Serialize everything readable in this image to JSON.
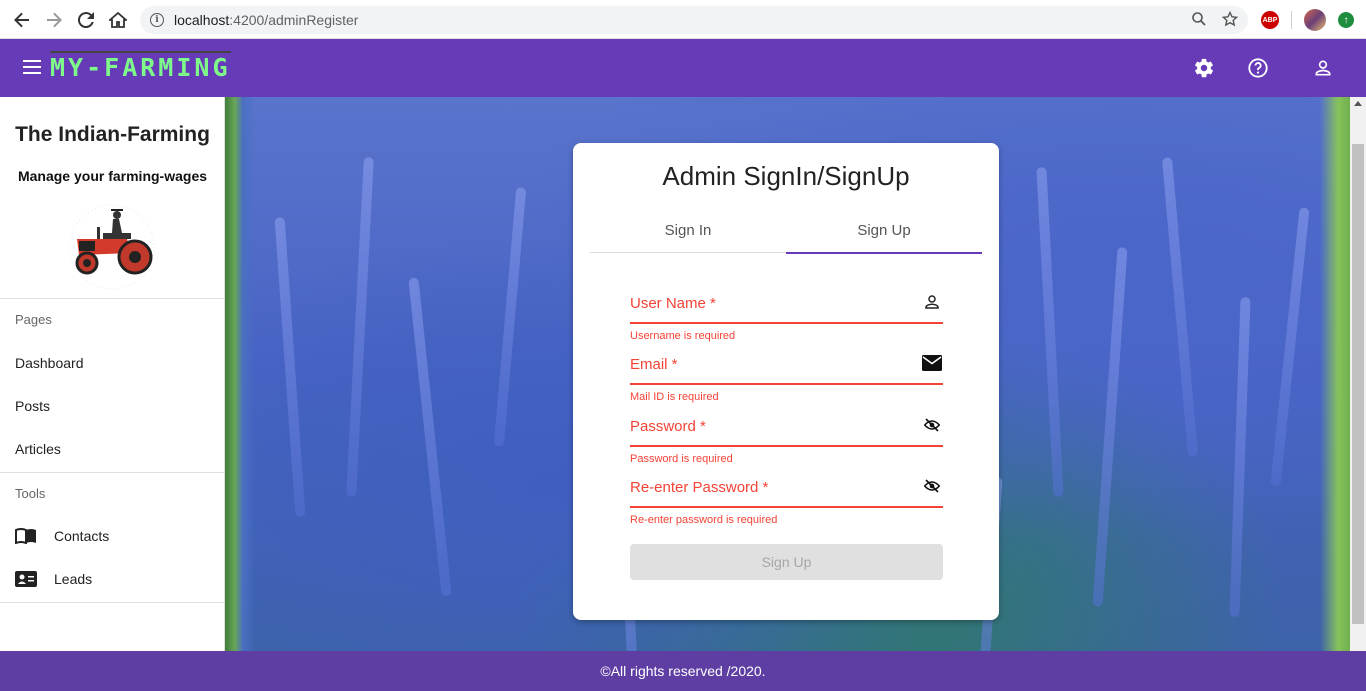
{
  "browser": {
    "url_host": "localhost",
    "url_path": ":4200/adminRegister",
    "icons": [
      "back-icon",
      "forward-icon",
      "reload-icon",
      "home-icon",
      "info-icon",
      "zoom-icon",
      "star-icon",
      "abp-icon",
      "profile-avatar",
      "extension-icon"
    ],
    "abp_label": "ABP"
  },
  "toolbar": {
    "logo": "MY-FARMING",
    "bg_color": "#673ab7",
    "logo_color": "#7dfa8a",
    "icons": [
      "menu-icon",
      "settings-icon",
      "help-icon",
      "account-icon"
    ]
  },
  "sidebar": {
    "title": "The Indian-Farming",
    "subtitle": "Manage your farming-wages",
    "pages_header": "Pages",
    "pages": [
      {
        "label": "Dashboard"
      },
      {
        "label": "Posts"
      },
      {
        "label": "Articles"
      }
    ],
    "tools_header": "Tools",
    "tools": [
      {
        "label": "Contacts",
        "icon": "book-icon"
      },
      {
        "label": "Leads",
        "icon": "contact-card-icon"
      }
    ]
  },
  "card": {
    "title": "Admin SignIn/SignUp",
    "tabs": [
      {
        "label": "Sign In",
        "active": false
      },
      {
        "label": "Sign Up",
        "active": true
      }
    ],
    "fields": [
      {
        "label": "User Name *",
        "error": "Username is required",
        "icon": "person-icon"
      },
      {
        "label": "Email *",
        "error": "Mail ID is required",
        "icon": "mail-icon"
      },
      {
        "label": "Password *",
        "error": "Password is required",
        "icon": "visibility-off-icon"
      },
      {
        "label": "Re-enter Password *",
        "error": "Re-enter password is required",
        "icon": "visibility-off-icon"
      }
    ],
    "submit_label": "Sign Up",
    "error_color": "#f44336"
  },
  "footer": {
    "text": "©All rights reserved /2020."
  }
}
